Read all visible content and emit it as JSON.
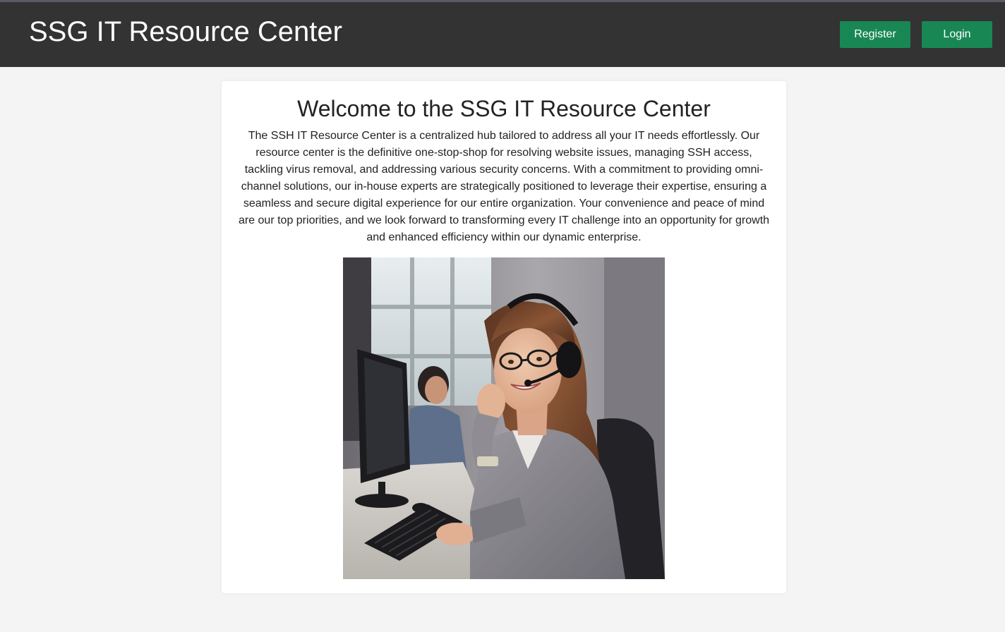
{
  "header": {
    "site_title": "SSG IT Resource Center",
    "register_label": "Register",
    "login_label": "Login",
    "button_color": "#198754",
    "background_color": "#333333"
  },
  "main": {
    "heading": "Welcome to the SSG IT Resource Center",
    "intro": "The SSH IT Resource Center is a centralized hub tailored to address all your IT needs effortlessly. Our resource center is the definitive one-stop-shop for resolving website issues, managing SSH access, tackling virus removal, and addressing various security concerns. With a commitment to providing omni-channel solutions, our in-house experts are strategically positioned to leverage their expertise, ensuring a seamless and secure digital experience for our entire organization. Your convenience and peace of mind are our top priorities, and we look forward to transforming every IT challenge into an opportunity for growth and enhanced efficiency within our dynamic enterprise.",
    "image": {
      "subject": "smiling support agent with headset at computer"
    }
  }
}
